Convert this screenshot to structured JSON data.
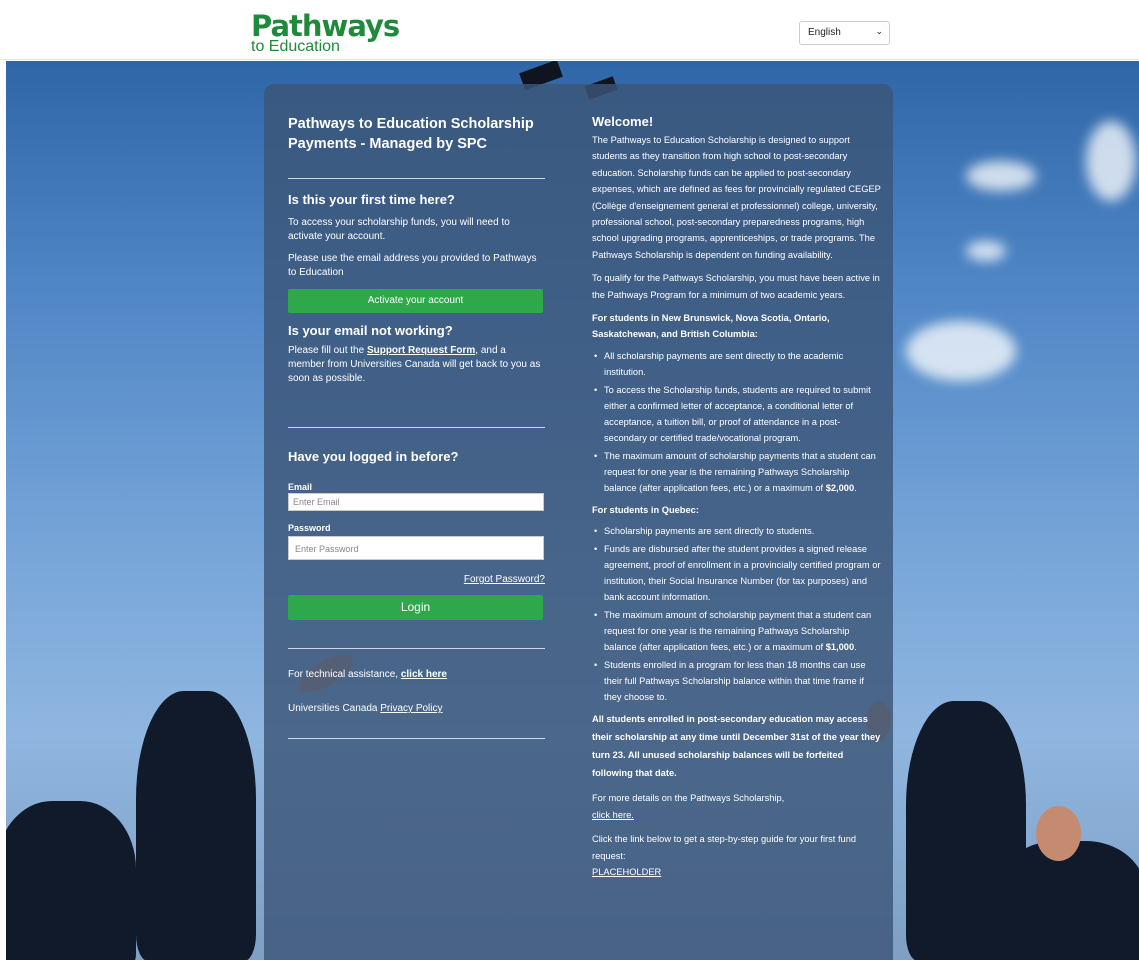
{
  "header": {
    "logo_main": "Pathways",
    "logo_sub": "to Education",
    "language_selected": "English"
  },
  "colors": {
    "brand_green": "#1f8a3c",
    "button_green": "#2ea84a",
    "panel": "#3c5678"
  },
  "left": {
    "title": "Pathways to Education Scholarship Payments - Managed by SPC",
    "first_time": {
      "heading": "Is this your first time here?",
      "p1": "To access your scholarship funds, you will need to activate your account.",
      "p2": "Please use the email address you provided to Pathways to Education",
      "button": "Activate your account"
    },
    "email_issue": {
      "heading": "Is your email not working?",
      "p_before": "Please fill out the ",
      "link": "Support Request Form",
      "p_after": ", and a member from Universities Canada will get back to you as soon as possible."
    },
    "login": {
      "heading": "Have you logged in before?",
      "email_label": "Email",
      "email_placeholder": "Enter Email",
      "password_label": "Password",
      "password_placeholder": "Enter Password",
      "forgot": "Forgot Password?",
      "button": "Login"
    },
    "tech_prefix": "For technical assistance, ",
    "tech_link": "click here",
    "privacy_prefix": "Universities Canada ",
    "privacy_link": "Privacy Policy"
  },
  "right": {
    "heading": "Welcome!",
    "p1": "The Pathways to Education Scholarship is designed to support students as they transition from high school to post-secondary education. Scholarship funds can be applied to post-secondary expenses, which are defined as fees for provincially regulated CEGEP (Collège d'enseignement general et professionnel) college, university, professional school, post-secondary preparedness programs, high school upgrading programs, apprenticeships, or trade programs. The Pathways Scholarship is dependent on funding availability.",
    "p2": "To qualify for the Pathways Scholarship, you must have been active in the Pathways Program for a minimum of two academic years.",
    "group1_heading": "For students in New Brunswick, Nova Scotia, Ontario, Saskatchewan, and British Columbia:",
    "group1_items": [
      "All scholarship payments are sent directly to the academic institution.",
      "To access the Scholarship funds, students are required to submit either a confirmed letter of acceptance, a conditional letter of acceptance, a tuition bill, or proof of attendance in a post-secondary or certified trade/vocational program."
    ],
    "group1_item3_prefix": "The maximum amount of scholarship payments that a student can request for one year is the remaining Pathways Scholarship balance (after application fees, etc.) or a maximum of ",
    "group1_item3_amount": "$2,000",
    "group2_heading": "For students in Quebec:",
    "group2_items": [
      "Scholarship payments are sent directly to students.",
      "Funds are disbursed after the student provides a signed release agreement, proof of enrollment in a provincially certified program or institution, their Social Insurance Number (for tax purposes) and bank account information."
    ],
    "group2_item3_prefix": "The maximum amount of scholarship payment that a student can request for one year is the remaining Pathways Scholarship balance (after application fees, etc.) or a maximum of ",
    "group2_item3_amount": "$1,000",
    "group2_item4": "Students enrolled in a program for less than 18 months can use their full Pathways Scholarship balance within that time frame if they choose to.",
    "bold_notice": "All students enrolled in post-secondary education may access their scholarship at any time until December 31st of the year they turn 23. All unused scholarship balances will be forfeited following that date.",
    "more_details": "For more details on the Pathways Scholarship,",
    "more_link": "click here.",
    "guide_text": "Click the link below to get a step-by-step guide for your first fund request:",
    "guide_link": "PLACEHOLDER"
  }
}
